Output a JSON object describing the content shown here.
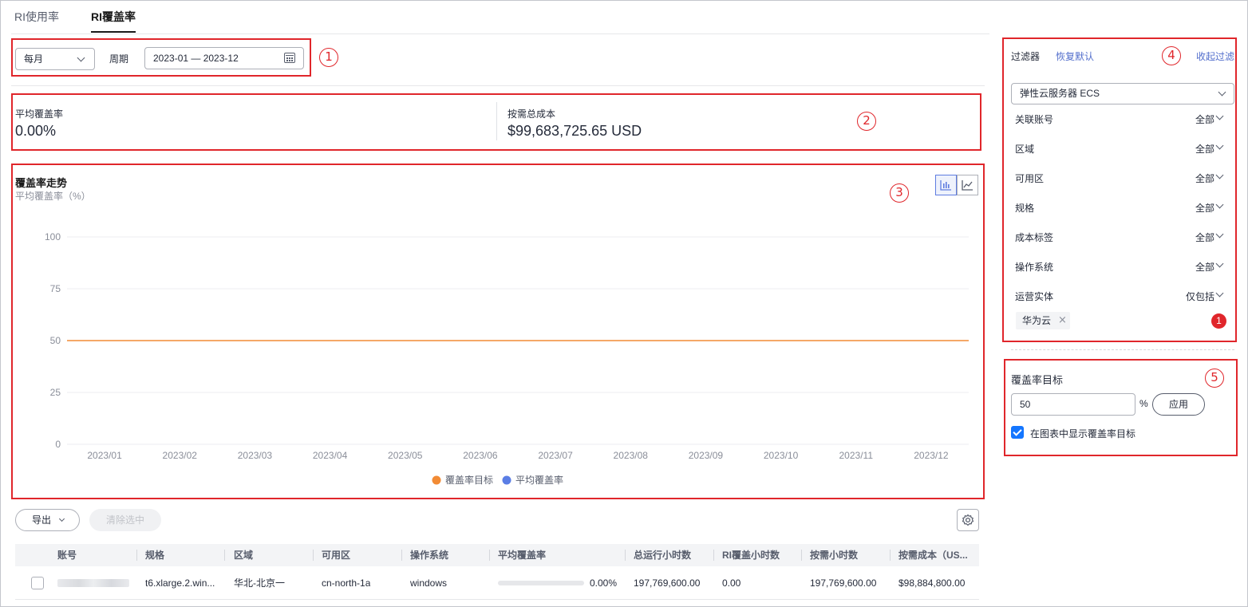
{
  "tabs": [
    {
      "label": "RI使用率",
      "active": false
    },
    {
      "label": "RI覆盖率",
      "active": true
    }
  ],
  "period": {
    "granularity": "每月",
    "label": "周期",
    "range": "2023-01 — 2023-12"
  },
  "markers": [
    "1",
    "2",
    "3",
    "4",
    "5"
  ],
  "summary": {
    "avg_coverage_label": "平均覆盖率",
    "avg_coverage_value": "0.00%",
    "ondemand_cost_label": "按需总成本",
    "ondemand_cost_value": "$99,683,725.65 USD"
  },
  "chart": {
    "title": "覆盖率走势",
    "subtitle": "平均覆盖率（%）",
    "view_icons": [
      "bar-chart-icon",
      "line-chart-icon"
    ]
  },
  "chart_data": {
    "type": "line",
    "title": "覆盖率走势",
    "ylabel": "平均覆盖率（%）",
    "ylim": [
      0,
      100
    ],
    "yticks": [
      0,
      25,
      50,
      75,
      100
    ],
    "categories": [
      "2023/01",
      "2023/02",
      "2023/03",
      "2023/04",
      "2023/05",
      "2023/06",
      "2023/07",
      "2023/08",
      "2023/09",
      "2023/10",
      "2023/11",
      "2023/12"
    ],
    "series": [
      {
        "name": "覆盖率目标",
        "color": "#f28b35",
        "values": [
          50,
          50,
          50,
          50,
          50,
          50,
          50,
          50,
          50,
          50,
          50,
          50
        ]
      },
      {
        "name": "平均覆盖率",
        "color": "#5b7ee5",
        "values": [
          0,
          0,
          0,
          0,
          0,
          0,
          0,
          0,
          0,
          0,
          0,
          0
        ]
      }
    ],
    "legend": "bottom-center",
    "grid": true
  },
  "table": {
    "export_label": "导出",
    "clear_label": "清除选中",
    "columns": [
      "账号",
      "规格",
      "区域",
      "可用区",
      "操作系统",
      "平均覆盖率",
      "总运行小时数",
      "RI覆盖小时数",
      "按需小时数",
      "按需成本（US..."
    ],
    "rows": [
      {
        "flavor": "t6.xlarge.2.win...",
        "region": "华北-北京一",
        "az": "cn-north-1a",
        "os": "windows",
        "coverage": "0.00%",
        "coverage_fraction": 0,
        "total_hours": "197,769,600.00",
        "ri_hours": "0.00",
        "ondemand_hours": "197,769,600.00",
        "ondemand_cost": "$98,884,800.00"
      }
    ]
  },
  "filters": {
    "title": "过滤器",
    "reset_label": "恢复默认",
    "collapse_label": "收起过滤",
    "service": "弹性云服务器 ECS",
    "items": [
      {
        "label": "关联账号",
        "value": "全部"
      },
      {
        "label": "区域",
        "value": "全部"
      },
      {
        "label": "可用区",
        "value": "全部"
      },
      {
        "label": "规格",
        "value": "全部"
      },
      {
        "label": "成本标签",
        "value": "全部"
      },
      {
        "label": "操作系统",
        "value": "全部"
      },
      {
        "label": "运营实体",
        "value": "仅包括"
      }
    ],
    "tag": "华为云",
    "tag_count": "1"
  },
  "goal": {
    "title": "覆盖率目标",
    "value": "50",
    "unit": "%",
    "apply_label": "应用",
    "show_label": "在图表中显示覆盖率目标",
    "show_checked": true
  }
}
